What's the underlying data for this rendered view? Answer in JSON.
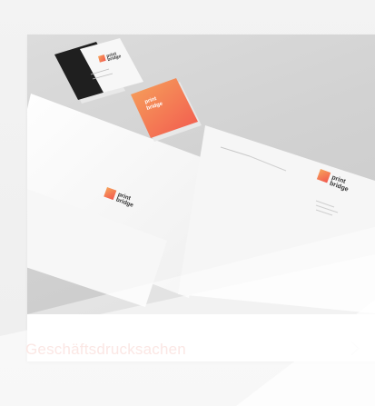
{
  "card": {
    "title": "Geschäftsdrucksachen",
    "image_alt_brand_line1": "print",
    "image_alt_brand_line2": "bridge"
  },
  "colors": {
    "accent": "#f6c9c3",
    "brand_orange": "#f08a3a",
    "brand_red": "#f25a5a",
    "dark_card": "#1f1f1f"
  },
  "icons": {
    "chevron": "chevron-right-icon"
  }
}
